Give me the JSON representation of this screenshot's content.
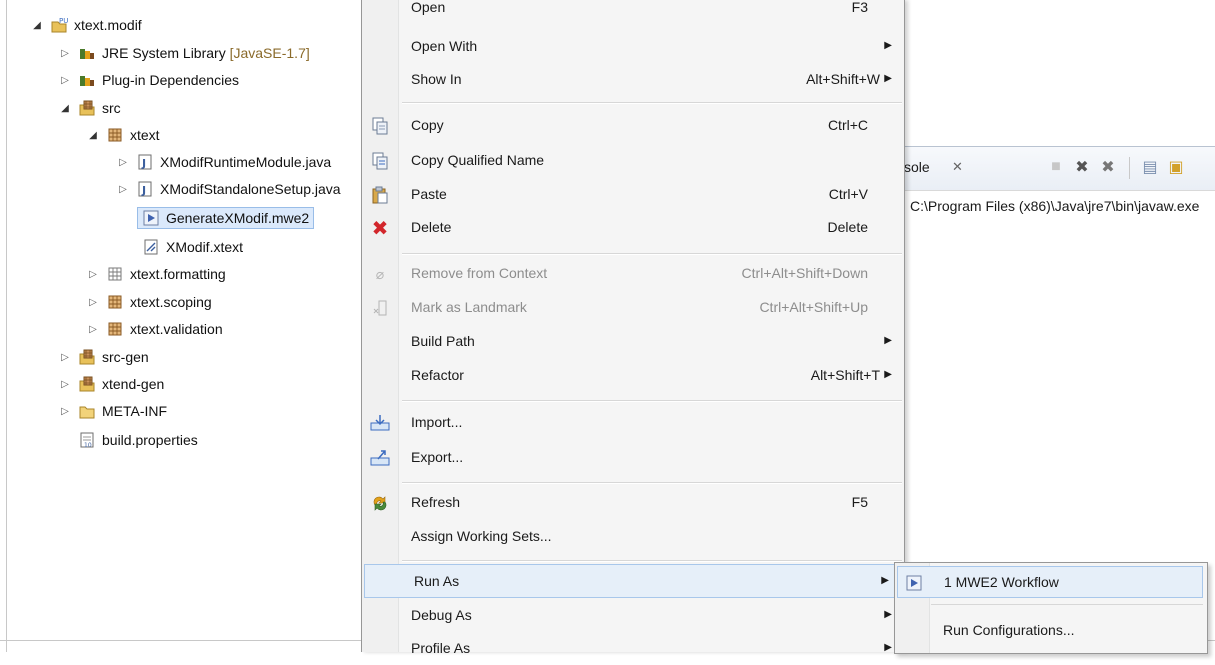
{
  "tree": {
    "items": [
      {
        "label": "xtext.modif",
        "deco": ""
      },
      {
        "label": "JRE System Library",
        "deco": "[JavaSE-1.7]"
      },
      {
        "label": "Plug-in Dependencies",
        "deco": ""
      },
      {
        "label": "src",
        "deco": ""
      },
      {
        "label": "xtext",
        "deco": ""
      },
      {
        "label": "XModifRuntimeModule.java",
        "deco": ""
      },
      {
        "label": "XModifStandaloneSetup.java",
        "deco": ""
      },
      {
        "label": "GenerateXModif.mwe2",
        "deco": ""
      },
      {
        "label": "XModif.xtext",
        "deco": ""
      },
      {
        "label": "xtext.formatting",
        "deco": ""
      },
      {
        "label": "xtext.scoping",
        "deco": ""
      },
      {
        "label": "xtext.validation",
        "deco": ""
      },
      {
        "label": "src-gen",
        "deco": ""
      },
      {
        "label": "xtend-gen",
        "deco": ""
      },
      {
        "label": "META-INF",
        "deco": ""
      },
      {
        "label": "build.properties",
        "deco": ""
      }
    ]
  },
  "console": {
    "tab_label": "sole",
    "path": "C:\\Program Files (x86)\\Java\\jre7\\bin\\javaw.exe"
  },
  "menu": {
    "items": [
      {
        "label": "Open",
        "accel": "F3"
      },
      {
        "label": "Open With",
        "accel": ""
      },
      {
        "label": "Show In",
        "accel": "Alt+Shift+W"
      },
      {
        "label": "Copy",
        "accel": "Ctrl+C"
      },
      {
        "label": "Copy Qualified Name",
        "accel": ""
      },
      {
        "label": "Paste",
        "accel": "Ctrl+V"
      },
      {
        "label": "Delete",
        "accel": "Delete"
      },
      {
        "label": "Remove from Context",
        "accel": "Ctrl+Alt+Shift+Down"
      },
      {
        "label": "Mark as Landmark",
        "accel": "Ctrl+Alt+Shift+Up"
      },
      {
        "label": "Build Path",
        "accel": ""
      },
      {
        "label": "Refactor",
        "accel": "Alt+Shift+T"
      },
      {
        "label": "Import...",
        "accel": ""
      },
      {
        "label": "Export...",
        "accel": ""
      },
      {
        "label": "Refresh",
        "accel": "F5"
      },
      {
        "label": "Assign Working Sets...",
        "accel": ""
      },
      {
        "label": "Run As",
        "accel": ""
      },
      {
        "label": "Debug As",
        "accel": ""
      },
      {
        "label": "Profile As",
        "accel": ""
      }
    ]
  },
  "submenu": {
    "items": [
      {
        "label": "1 MWE2 Workflow"
      },
      {
        "label": "Run Configurations..."
      }
    ]
  },
  "colors": {
    "menu_bg": "#f5f5f5",
    "hover_bg": "#e6eff9",
    "hover_border": "#a8c7eb",
    "disabled_text": "#8d8d8d",
    "delete_red": "#d2262b"
  }
}
